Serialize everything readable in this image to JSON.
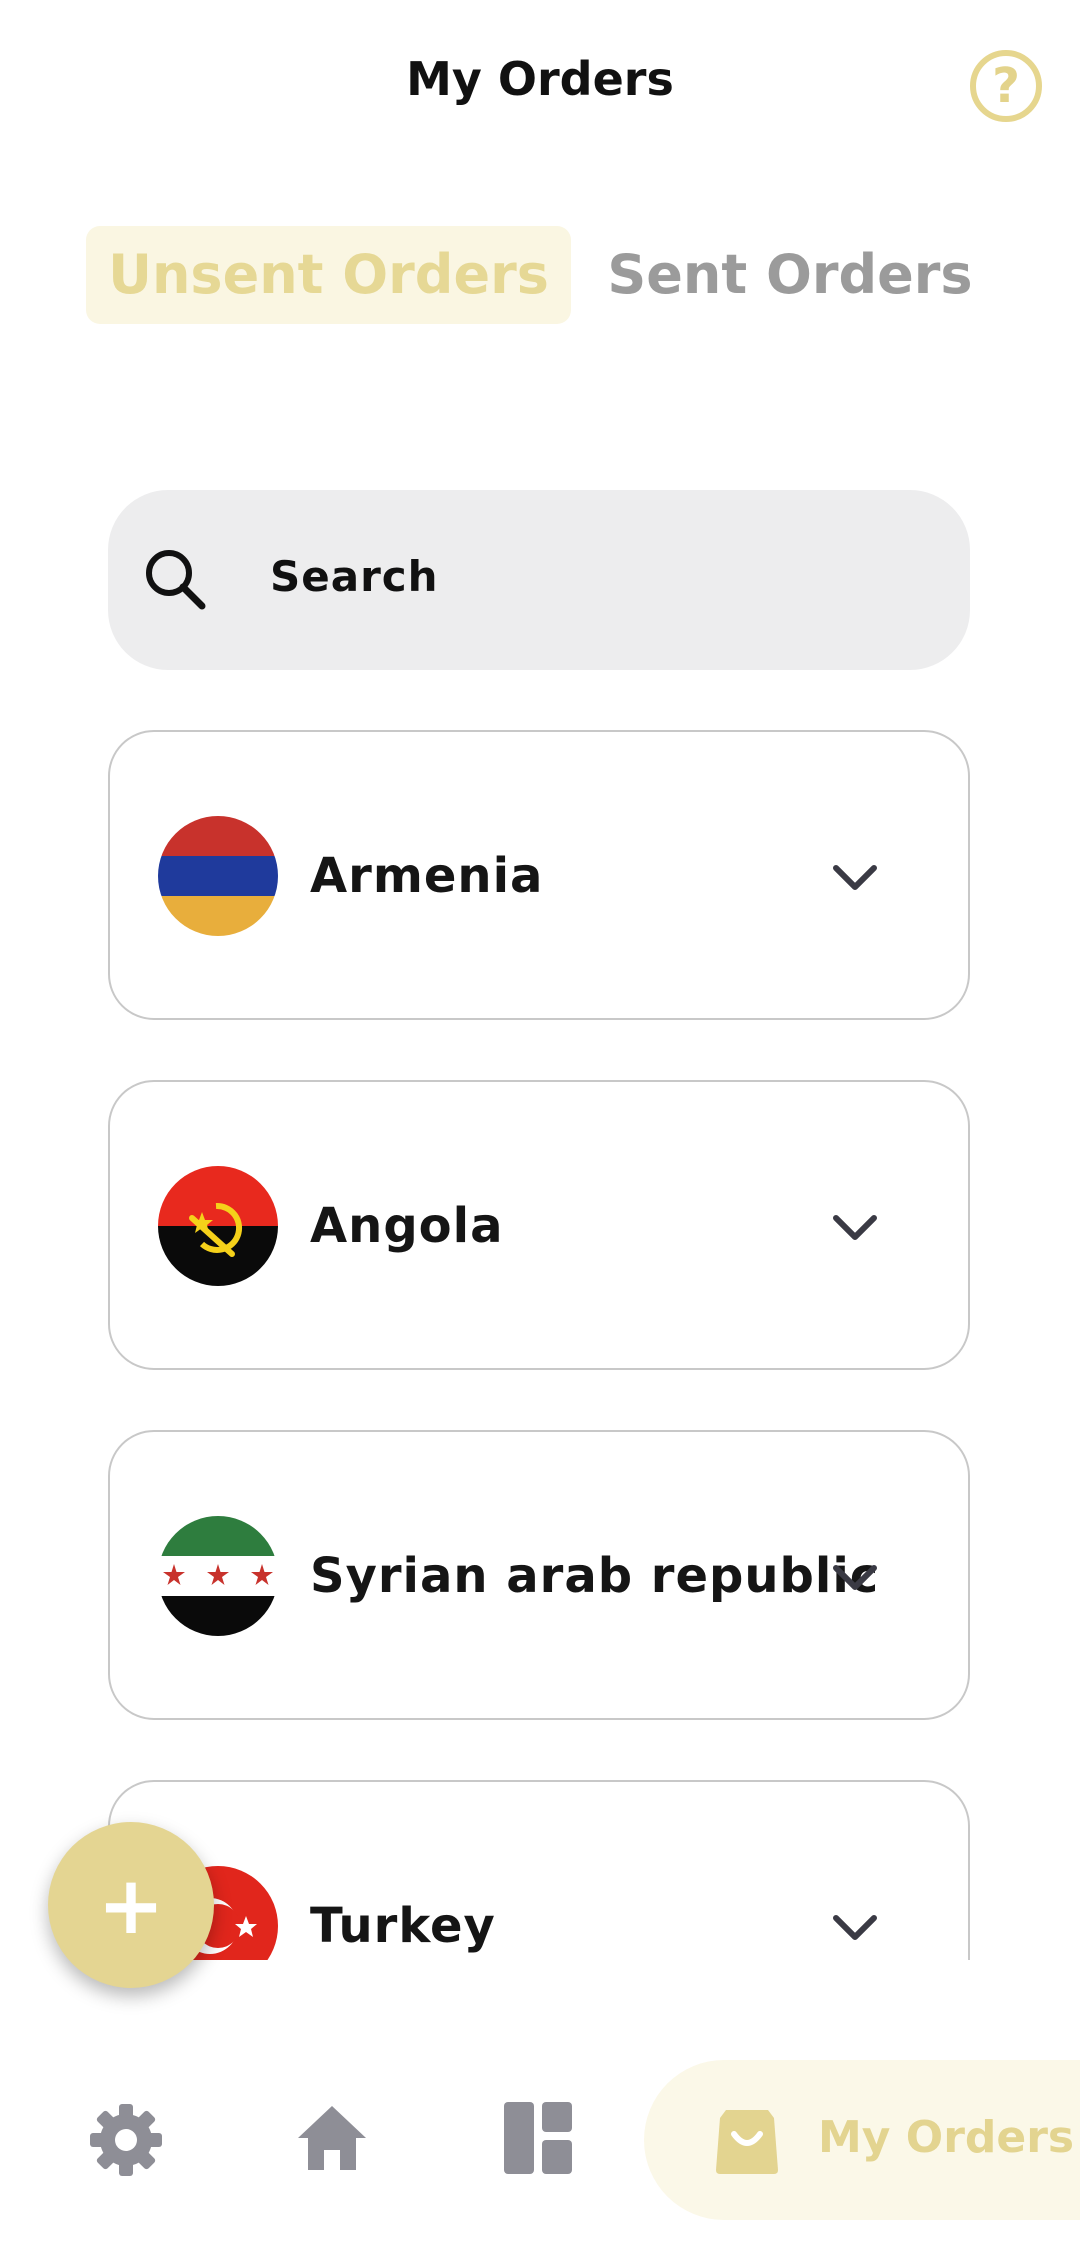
{
  "header": {
    "title": "My Orders",
    "help_glyph": "?",
    "help_icon": "question-circle-icon"
  },
  "tabs": [
    {
      "label": "Unsent Orders",
      "active": true
    },
    {
      "label": "Sent Orders",
      "active": false
    }
  ],
  "search": {
    "placeholder": "Search",
    "icon": "search-icon"
  },
  "countries": [
    {
      "name": "Armenia",
      "flag": "armenia-flag-icon"
    },
    {
      "name": "Angola",
      "flag": "angola-flag-icon"
    },
    {
      "name": "Syrian arab republic",
      "flag": "syria-flag-icon"
    },
    {
      "name": "Turkey",
      "flag": "turkey-flag-icon"
    }
  ],
  "fab": {
    "glyph": "+"
  },
  "nav": {
    "items": [
      {
        "icon": "gear-icon"
      },
      {
        "icon": "home-icon"
      },
      {
        "icon": "dashboard-icon"
      },
      {
        "icon": "shopping-bag-icon",
        "label": "My Orders",
        "active": true
      }
    ]
  },
  "colors": {
    "accent": "#e4d592",
    "accent_light": "#faf6e2",
    "inactive": "#9b9b9b",
    "icon_gray": "#8e8e96",
    "search_bg": "#ededee"
  }
}
